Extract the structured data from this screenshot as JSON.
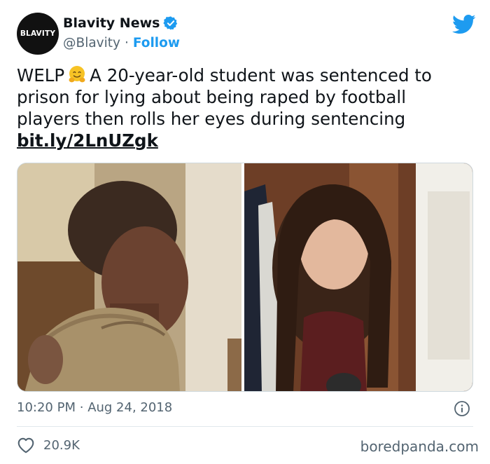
{
  "author": {
    "avatar_text": "BLAVITY",
    "display_name": "Blavity News",
    "handle": "@Blavity",
    "separator": "·",
    "follow_label": "Follow"
  },
  "tweet": {
    "text_before_emoji": "WELP",
    "text_after_emoji": "A 20-year-old student was sentenced to prison for lying about being raped by football players then rolls her eyes during sentencing",
    "link": "bit.ly/2LnUZgk"
  },
  "meta": {
    "time": "10:20 PM",
    "separator": "·",
    "date": "Aug 24, 2018"
  },
  "likes": {
    "count": "20.9K"
  },
  "watermark": "boredpanda.com",
  "colors": {
    "twitter_blue": "#1d9bf0",
    "text": "#0f1419",
    "secondary": "#536471"
  }
}
